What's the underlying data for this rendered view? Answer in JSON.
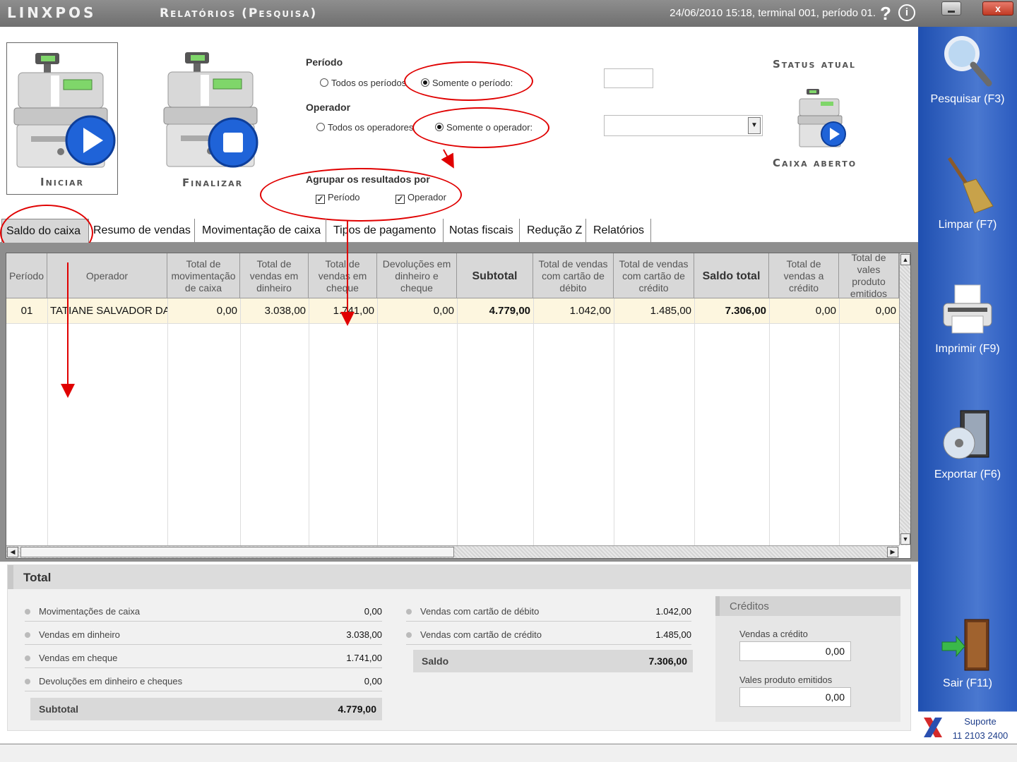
{
  "titlebar": {
    "app_name": "LINXPOS",
    "window_title": "Relatórios (Pesquisa)",
    "status": "24/06/2010 15:18, terminal 001, período 01.",
    "help": "?",
    "info": "i",
    "close": "x"
  },
  "actions": {
    "iniciar": "Iniciar",
    "finalizar": "Finalizar"
  },
  "filters": {
    "periodo_label": "Período",
    "periodo_all": "Todos os períodos",
    "periodo_only": "Somente o período:",
    "periodo_value": "",
    "operador_label": "Operador",
    "operador_all": "Todos os operadores",
    "operador_only": "Somente o operador:",
    "operador_value": "",
    "agrupar_label": "Agrupar os resultados por",
    "agrupar_periodo": "Período",
    "agrupar_operador": "Operador",
    "check_mark": "✓"
  },
  "status": {
    "title": "Status atual",
    "value": "Caixa aberto"
  },
  "tabs": [
    {
      "label": "Saldo do caixa"
    },
    {
      "label": "Resumo de vendas"
    },
    {
      "label": "Movimentação de caixa"
    },
    {
      "label": "Tipos de pagamento"
    },
    {
      "label": "Notas fiscais"
    },
    {
      "label": "Redução Z"
    },
    {
      "label": "Relatórios"
    }
  ],
  "grid": {
    "columns": [
      "Período",
      "Operador",
      "Total de movimentação de caixa",
      "Total de vendas em dinheiro",
      "Total de vendas em cheque",
      "Devoluções em dinheiro e cheque",
      "Subtotal",
      "Total de vendas com cartão de débito",
      "Total de vendas com cartão de crédito",
      "Saldo total",
      "Total de vendas a crédito",
      "Total de vales produto emitidos"
    ],
    "row": [
      "01",
      "TATIANE SALVADOR DA S",
      "0,00",
      "3.038,00",
      "1.741,00",
      "0,00",
      "4.779,00",
      "1.042,00",
      "1.485,00",
      "7.306,00",
      "0,00",
      "0,00"
    ]
  },
  "totals": {
    "title": "Total",
    "left": [
      {
        "label": "Movimentações de caixa",
        "value": "0,00"
      },
      {
        "label": "Vendas em dinheiro",
        "value": "3.038,00"
      },
      {
        "label": "Vendas em cheque",
        "value": "1.741,00"
      },
      {
        "label": "Devoluções em dinheiro e cheques",
        "value": "0,00"
      }
    ],
    "subtotal_label": "Subtotal",
    "subtotal_value": "4.779,00",
    "mid": [
      {
        "label": "Vendas com cartão de débito",
        "value": "1.042,00"
      },
      {
        "label": "Vendas com cartão de crédito",
        "value": "1.485,00"
      }
    ],
    "saldo_label": "Saldo",
    "saldo_value": "7.306,00",
    "creditos_title": "Créditos",
    "vendas_credito_label": "Vendas a crédito",
    "vendas_credito_value": "0,00",
    "vales_label": "Vales produto emitidos",
    "vales_value": "0,00"
  },
  "sidebar": {
    "pesquisar": "Pesquisar (F3)",
    "limpar": "Limpar (F7)",
    "imprimir": "Imprimir (F9)",
    "exportar": "Exportar (F6)",
    "sair": "Sair (F11)",
    "suporte_label": "Suporte",
    "suporte_phone": "11 2103 2400"
  },
  "colors": {
    "sidebar": "#2b5bbf",
    "annotation": "#e00000",
    "row_highlight": "#fdf6df"
  }
}
